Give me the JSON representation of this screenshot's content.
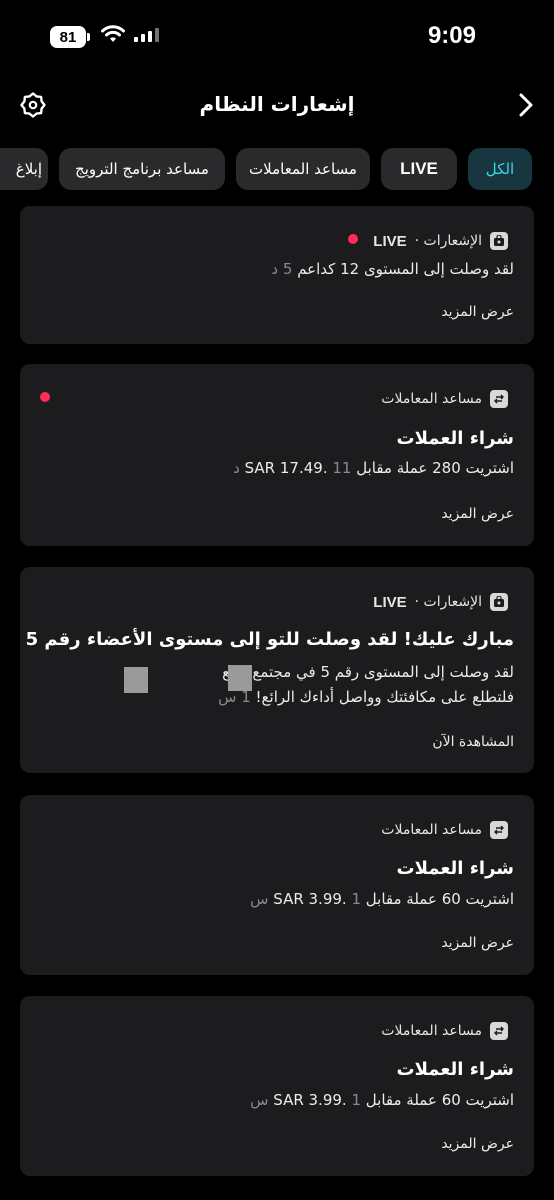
{
  "status": {
    "time": "9:09",
    "battery": "81"
  },
  "header": {
    "title": "إشعارات النظام",
    "gear_icon": "gear-icon",
    "back_icon": "chevron-right-icon"
  },
  "tabs": [
    {
      "label": "الكل",
      "active": true
    },
    {
      "label": "LIVE"
    },
    {
      "label": "مساعد المعاملات"
    },
    {
      "label": "مساعد برنامج الترويج"
    },
    {
      "label": "إبلاغ"
    }
  ],
  "cards": [
    {
      "source": "الإشعارات ·",
      "live": "LIVE",
      "body": "لقد وصلت إلى المستوى 12 كداعم",
      "time": "5 د",
      "more": "عرض المزيد"
    },
    {
      "source": "مساعد المعاملات",
      "title": "شراء العملات",
      "body": "اشتريت 280 عملة مقابل SAR 17.49.",
      "time": "11 د",
      "more": "عرض المزيد"
    },
    {
      "source": "الإشعارات ·",
      "live": "LIVE",
      "title": "مبارك عليك! لقد وصلت للتو إلى مستوى الأعضاء رقم 5",
      "body1": "لقد وصلت إلى المستوى رقم 5 في مجتمع المع",
      "body2": "فلتطلع على مكافئتك وواصل أداءك الرائع!",
      "time": "1 س",
      "more": "المشاهدة الآن"
    },
    {
      "source": "مساعد المعاملات",
      "title": "شراء العملات",
      "body": "اشتريت 60 عملة مقابل SAR 3.99.",
      "time": "1 س",
      "more": "عرض المزيد"
    },
    {
      "source": "مساعد المعاملات",
      "title": "شراء العملات",
      "body": "اشتريت 60 عملة مقابل SAR 3.99.",
      "time": "1 س",
      "more": "عرض المزيد"
    }
  ],
  "colors": {
    "accent": "#38d6e8",
    "unread": "#ff2d55",
    "card": "#1c1c1e"
  }
}
